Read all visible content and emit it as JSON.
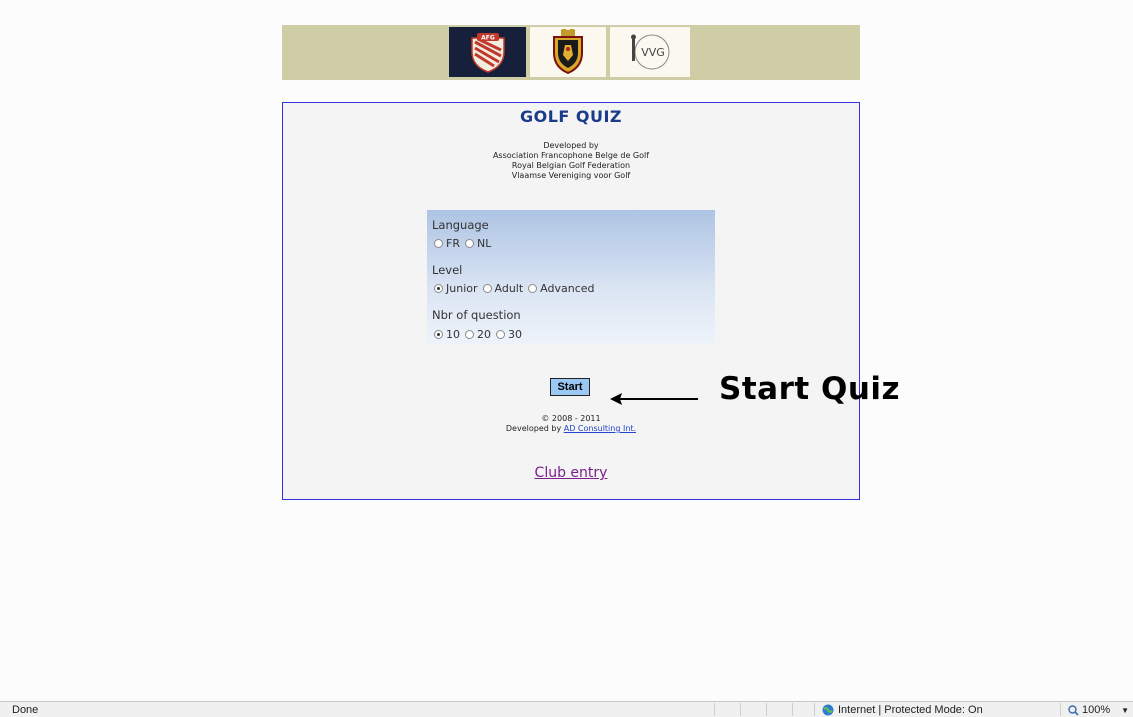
{
  "banner": {
    "logos": [
      {
        "name": "afg-logo",
        "text": "AFG"
      },
      {
        "name": "rbgf-crest-logo",
        "text": ""
      },
      {
        "name": "vvg-logo",
        "text": "VVG"
      }
    ]
  },
  "quiz": {
    "title": "GOLF QUIZ",
    "developed_by": "Developed by",
    "orgs": [
      "Association Francophone Belge de Golf",
      "Royal Belgian Golf Federation",
      "Vlaamse Vereniging voor Golf"
    ],
    "language": {
      "label": "Language",
      "options": [
        {
          "label": "FR",
          "checked": false
        },
        {
          "label": "NL",
          "checked": false
        }
      ]
    },
    "level": {
      "label": "Level",
      "options": [
        {
          "label": "Junior",
          "checked": true
        },
        {
          "label": "Adult",
          "checked": false
        },
        {
          "label": "Advanced",
          "checked": false
        }
      ]
    },
    "questions": {
      "label": "Nbr of question",
      "options": [
        {
          "label": "10",
          "checked": true
        },
        {
          "label": "20",
          "checked": false
        },
        {
          "label": "30",
          "checked": false
        }
      ]
    },
    "start_label": "Start",
    "annotation": "Start Quiz",
    "copyright": "© 2008 - 2011",
    "developed_by_prefix": "Developed by",
    "developer_link": "AD Consulting Int.",
    "club_entry": "Club entry"
  },
  "statusbar": {
    "status": "Done",
    "zone": "Internet | Protected Mode: On",
    "zoom": "100%"
  },
  "colors": {
    "banner_bg": "#cfcda6",
    "panel_border": "#3333dd",
    "title": "#1a3a8a",
    "start_button": "#9bc7f3",
    "club_link": "#7a1f8a"
  }
}
